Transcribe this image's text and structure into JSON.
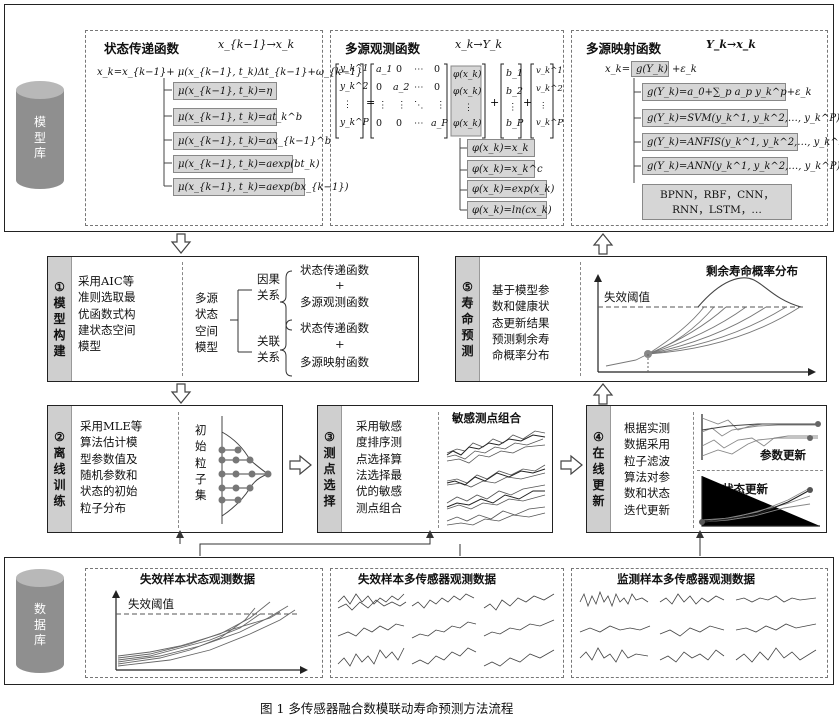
{
  "top": {
    "db_label": "模型库",
    "state": {
      "title": "状态传递函数",
      "title_math": "x_{k−1}→x_k",
      "equation": "x_k=x_{k−1}+ μ(x_{k−1}, t_k)Δt_{k−1}+ω_{k−1}",
      "options": [
        "μ(x_{k−1}, t_k)=η",
        "μ(x_{k−1}, t_k)=at_k^b",
        "μ(x_{k−1}, t_k)=ax_{k−1}^b",
        "μ(x_{k−1}, t_k)=aexp(bt_k)",
        "μ(x_{k−1}, t_k)=aexp(bx_{k−1})"
      ]
    },
    "obs": {
      "title": "多源观测函数",
      "title_math": "x_k→Y_k",
      "lhs": [
        "y_k^1",
        "y_k^2",
        "⋮",
        "y_k^P"
      ],
      "matrix_rows": [
        [
          "a_1",
          "0",
          "⋯",
          "0"
        ],
        [
          "0",
          "a_2",
          "⋯",
          "0"
        ],
        [
          "⋮",
          "⋮",
          "⋱",
          "⋮"
        ],
        [
          "0",
          "0",
          "⋯",
          "a_P"
        ]
      ],
      "phi_vec": [
        "φ(x_k)",
        "φ(x_k)",
        "⋮",
        "φ(x_k)"
      ],
      "b_vec": [
        "b_1",
        "b_2",
        "⋮",
        "b_P"
      ],
      "v_vec": [
        "v_k^1",
        "v_k^2",
        "⋮",
        "v_k^P"
      ],
      "options": [
        "φ(x_k)=x_k",
        "φ(x_k)=x_k^c",
        "φ(x_k)=exp(x_k)",
        "φ(x_k)=ln(cx_k)"
      ]
    },
    "map": {
      "title": "多源映射函数",
      "title_math": "Y_k→x_k",
      "equation_pre": "x_k=",
      "equation_box": "g(Y_k)",
      "equation_post": "+ε_k",
      "options": [
        "g(Y_k)=a_0+∑_p a_p y_k^p+ε_k",
        "g(Y_k)=SVM(y_k^1, y_k^2,…, y_k^P)",
        "g(Y_k)=ANFIS(y_k^1, y_k^2,…, y_k^P)",
        "g(Y_k)=ANN(y_k^1, y_k^2,…, y_k^P)"
      ],
      "ann_list_1": "BPNN，RBF，CNN，",
      "ann_list_2": "RNN，LSTM，…"
    }
  },
  "step1": {
    "tab": "①\n模\n型\n构\n建",
    "desc": "采用AIC等\n准则选取最\n优函数式构\n建状态空间\n模型",
    "space_model": "多源\n状态\n空间\n模型",
    "causal": "因果\n关系",
    "assoc": "关联\n关系",
    "causal_items": [
      "状态传递函数",
      "+",
      "多源观测函数"
    ],
    "assoc_items": [
      "状态传递函数",
      "+",
      "多源映射函数"
    ]
  },
  "step5": {
    "tab": "⑤\n寿\n命\n预\n测",
    "desc": "基于模型参\n数和健康状\n态更新结果\n预测剩余寿\n命概率分布",
    "chart_title": "剩余寿命概率分布",
    "threshold_label": "失效阈值"
  },
  "step2": {
    "tab": "②\n离\n线\n训\n练",
    "desc": "采用MLE等\n算法估计模\n型参数值及\n随机参数和\n状态的初始\n粒子分布",
    "particle_label": "初\n始\n粒\n子\n集"
  },
  "step3": {
    "tab": "③\n测\n点\n选\n择",
    "desc": "采用敏感\n度排序测\n点选择算\n法选择最\n优的敏感\n测点组合",
    "chart_title": "敏感测点组合"
  },
  "step4": {
    "tab": "④\n在\n线\n更\n新",
    "desc": "根据实测\n数据采用\n粒子滤波\n算法对参\n数和状态\n迭代更新",
    "param_label": "参数更新",
    "state_label": "状态更新"
  },
  "bottom": {
    "db_label": "数据库",
    "panel1_title": "失效样本状态观测数据",
    "panel1_threshold": "失效阈值",
    "panel2_title": "失效样本多传感器观测数据",
    "panel3_title": "监测样本多传感器观测数据"
  },
  "caption": "图 1    多传感器融合数模联动寿命预测方法流程"
}
